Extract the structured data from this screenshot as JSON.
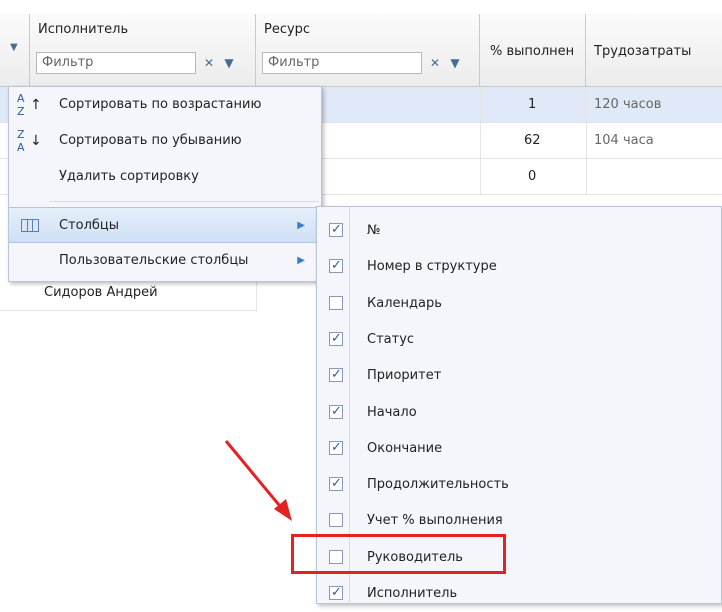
{
  "header": {
    "col_performer": "Исполнитель",
    "col_resource": "Ресурс",
    "col_percent": "% выполнен",
    "col_labor": "Трудозатраты",
    "filter_placeholder": "Фильтр",
    "filter_clear": "✕",
    "filter_dropdown": "▼"
  },
  "rows": [
    {
      "percent": "1",
      "labor": "120 часов"
    },
    {
      "percent": "62",
      "labor": "104 часа"
    },
    {
      "percent": "0",
      "labor": ""
    }
  ],
  "extra_row": {
    "performer": "Сидоров Андрей"
  },
  "context_menu": {
    "sort_asc": "Сортировать по возрастанию",
    "sort_desc": "Сортировать по убыванию",
    "remove_sort": "Удалить сортировку",
    "columns": "Столбцы",
    "custom_columns": "Пользовательские столбцы"
  },
  "columns_menu": [
    {
      "label": "№",
      "checked": true
    },
    {
      "label": "Номер в структуре",
      "checked": true
    },
    {
      "label": "Календарь",
      "checked": false
    },
    {
      "label": "Статус",
      "checked": true
    },
    {
      "label": "Приоритет",
      "checked": true
    },
    {
      "label": "Начало",
      "checked": true
    },
    {
      "label": "Окончание",
      "checked": true
    },
    {
      "label": "Продолжительность",
      "checked": true
    },
    {
      "label": "Учет % выполнения",
      "checked": false
    },
    {
      "label": "Руководитель",
      "checked": false
    },
    {
      "label": "Исполнитель",
      "checked": true
    }
  ],
  "colors": {
    "accent": "#3a7cc8",
    "highlight": "#e52222"
  }
}
